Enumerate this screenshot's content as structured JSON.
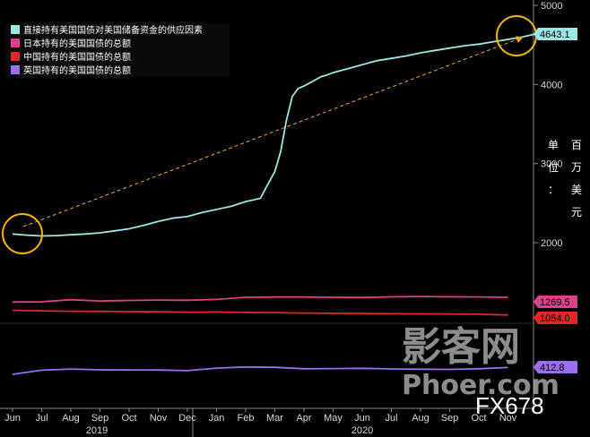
{
  "chart_data": {
    "type": "line",
    "title": "",
    "unit_label": "单位：百万美元",
    "x_year_labels": [
      "2019",
      "2020"
    ],
    "x_month_labels": [
      "Jun",
      "Jul",
      "Aug",
      "Sep",
      "Oct",
      "Nov",
      "Dec",
      "Jan",
      "Feb",
      "Mar",
      "Apr",
      "May",
      "Jun",
      "Jul",
      "Aug",
      "Sep",
      "Oct",
      "Nov"
    ],
    "y_ticks": [
      2000,
      3000,
      4000,
      5000
    ],
    "ylim": [
      1200,
      5000
    ],
    "grid": false,
    "legend_position": "top-left",
    "series": [
      {
        "name": "直接持有美国国债对美国储备资金的供应因素",
        "color": "#9ee6e6",
        "last_value_label": "4643.1",
        "x": [
          0,
          0.5,
          1,
          1.5,
          2,
          2.5,
          3,
          3.5,
          4,
          4.5,
          5,
          5.5,
          6,
          6.5,
          7,
          7.5,
          8,
          8.5,
          9,
          9.2,
          9.4,
          9.6,
          9.8,
          10,
          10.2,
          10.4,
          10.6,
          10.8,
          11,
          11.5,
          12,
          12.5,
          13,
          13.5,
          14,
          14.5,
          15,
          15.5,
          16,
          16.5,
          17,
          17.5,
          18
        ],
        "values": [
          2110,
          2095,
          2085,
          2090,
          2100,
          2110,
          2125,
          2150,
          2175,
          2220,
          2270,
          2310,
          2330,
          2380,
          2420,
          2460,
          2520,
          2560,
          2900,
          3150,
          3550,
          3850,
          3950,
          3980,
          4020,
          4060,
          4100,
          4120,
          4150,
          4200,
          4250,
          4300,
          4330,
          4360,
          4400,
          4430,
          4460,
          4490,
          4510,
          4540,
          4570,
          4600,
          4643
        ]
      },
      {
        "name": "日本持有的美国国债的总额",
        "color": "#e0408a",
        "last_value_label": "1269.5",
        "x": [
          0,
          1,
          2,
          3,
          4,
          5,
          6,
          7,
          8,
          9,
          10,
          11,
          12,
          13,
          14,
          15,
          16,
          17
        ],
        "values": [
          1212,
          1215,
          1240,
          1225,
          1232,
          1236,
          1234,
          1244,
          1270,
          1273,
          1273,
          1270,
          1268,
          1276,
          1280,
          1276,
          1274,
          1270
        ]
      },
      {
        "name": "中国持有的美国国债的总额",
        "color": "#e02828",
        "last_value_label": "1054.0",
        "x": [
          0,
          1,
          2,
          3,
          4,
          5,
          6,
          7,
          8,
          9,
          10,
          11,
          12,
          13,
          14,
          15,
          16,
          17
        ],
        "values": [
          1110,
          1105,
          1100,
          1098,
          1095,
          1093,
          1088,
          1090,
          1085,
          1083,
          1078,
          1075,
          1073,
          1070,
          1068,
          1066,
          1064,
          1054
        ]
      },
      {
        "name": "英国持有的美国国债的总额",
        "color": "#9b6ef0",
        "last_value_label": "412.8",
        "x": [
          0,
          1,
          2,
          3,
          4,
          5,
          6,
          7,
          8,
          9,
          10,
          11,
          12,
          13,
          14,
          15,
          16,
          17
        ],
        "values": [
          330,
          380,
          395,
          385,
          384,
          382,
          375,
          405,
          420,
          415,
          398,
          400,
          403,
          396,
          392,
          390,
          398,
          413
        ]
      }
    ]
  },
  "watermark": {
    "line1": "影客网",
    "line2": "Phoer.com",
    "line3": "FX678"
  },
  "colors": {
    "background": "#000000",
    "axis": "#888888",
    "arrow": "#f5a623",
    "circle": "#f5b300"
  }
}
